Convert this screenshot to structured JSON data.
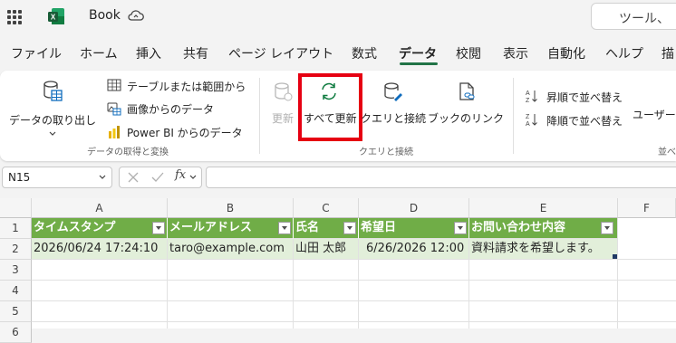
{
  "title_bar": {
    "book_name": "Book",
    "search_text": "ツール、"
  },
  "menu": {
    "tabs": [
      "ファイル",
      "ホーム",
      "挿入",
      "共有",
      "ページ レイアウト",
      "数式",
      "データ",
      "校閲",
      "表示",
      "自動化",
      "ヘルプ",
      "描"
    ],
    "active_tab": "データ"
  },
  "ribbon": {
    "get_transform": {
      "get_data": "データの取り出し",
      "from_table": "テーブルまたは範囲から",
      "from_image": "画像からのデータ",
      "from_powerbi": "Power BI からのデータ",
      "group_label": "データの取得と変換"
    },
    "queries": {
      "refresh": "更新",
      "refresh_all": "すべて更新",
      "queries_connections": "クエリと接続",
      "workbook_links": "ブックのリンク",
      "group_label": "クエリと接続"
    },
    "sort": {
      "sort_asc": "昇順で並べ替え",
      "sort_desc": "降順で並べ替え",
      "user": "ユーザー",
      "group_label": "並べ"
    }
  },
  "formula_bar": {
    "name_box": "N15",
    "fx": "fx"
  },
  "sheet": {
    "columns": [
      "A",
      "B",
      "C",
      "D",
      "E",
      "F"
    ],
    "rows": [
      "1",
      "2",
      "3",
      "4",
      "5",
      "6"
    ],
    "header_row": [
      "タイムスタンプ",
      "メールアドレス",
      "氏名",
      "希望日",
      "お問い合わせ内容"
    ],
    "data_row": [
      "2026/06/24 17:24:10",
      "taro@example.com",
      "山田 太郎",
      "6/26/2026 12:00",
      "資料請求を希望します。"
    ]
  },
  "colors": {
    "accent": "#217346",
    "table_header": "#70ad47",
    "table_band": "#e2efda",
    "highlight": "#e60012"
  }
}
